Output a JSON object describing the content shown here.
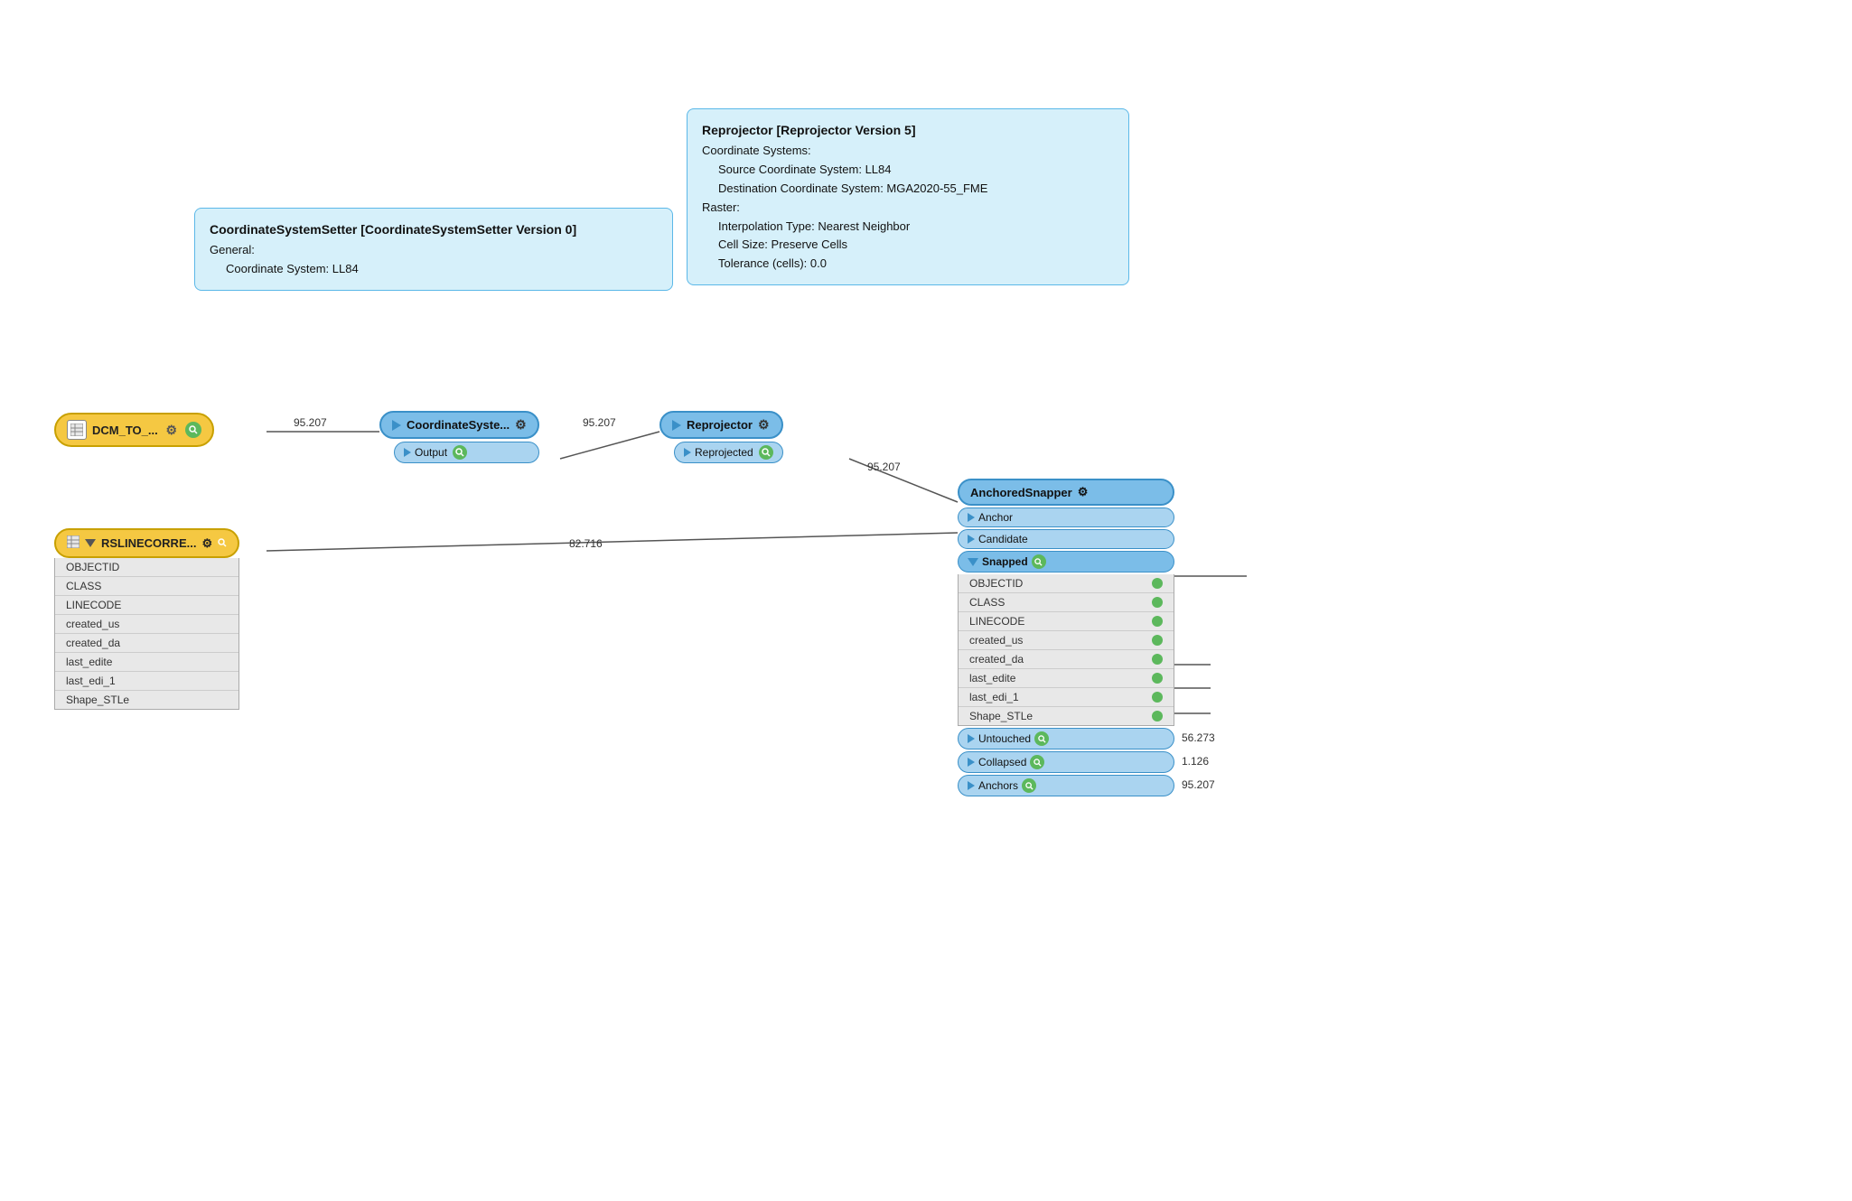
{
  "tooltip1": {
    "title": "CoordinateSystemSetter [CoordinateSystemSetter Version 0]",
    "lines": [
      "General:",
      "  Coordinate System: LL84"
    ]
  },
  "tooltip2": {
    "title": "Reprojector [Reprojector Version 5]",
    "lines": [
      "Coordinate Systems:",
      "  Source Coordinate System: LL84",
      "  Destination Coordinate System: MGA2020-55_FME",
      "Raster:",
      "  Interpolation Type: Nearest Neighbor",
      "  Cell Size: Preserve Cells",
      "  Tolerance (cells): 0.0"
    ]
  },
  "dcm_node": {
    "label": "DCM_TO_...",
    "icon": "table-icon",
    "gear": "⚙",
    "inspect": "🔍"
  },
  "coord_setter": {
    "label": "CoordinateSyste...",
    "gear": "⚙",
    "output_port": "Output",
    "inspect": "🔍"
  },
  "reprojector": {
    "label": "Reprojector",
    "gear": "⚙",
    "output_port": "Reprojected",
    "inspect": "🔍"
  },
  "anchored_snapper": {
    "label": "AnchoredSnapper",
    "gear": "⚙",
    "ports": {
      "anchor": "Anchor",
      "candidate": "Candidate",
      "snapped": "Snapped",
      "snapped_attrs": [
        "OBJECTID",
        "CLASS",
        "LINECODE",
        "created_us",
        "created_da",
        "last_edite",
        "last_edi_1",
        "Shape_STLe"
      ],
      "untouched": "Untouched",
      "collapsed": "Collapsed",
      "anchors": "Anchors"
    }
  },
  "rslinecorre": {
    "label": "RSLINECORRE...",
    "icon": "table-icon",
    "gear": "⚙",
    "inspect": "🔍",
    "attrs": [
      "OBJECTID",
      "CLASS",
      "LINECODE",
      "created_us",
      "created_da",
      "last_edite",
      "last_edi_1",
      "Shape_STLe"
    ]
  },
  "connections": {
    "dcm_to_coord": "95.207",
    "coord_to_reprojector": "95.207",
    "reprojector_to_anchored": "95.207",
    "rslinecorre_to_anchored": "82.716"
  },
  "output_counts": {
    "untouched": "56.273",
    "collapsed": "1.126",
    "anchors": "95.207"
  }
}
